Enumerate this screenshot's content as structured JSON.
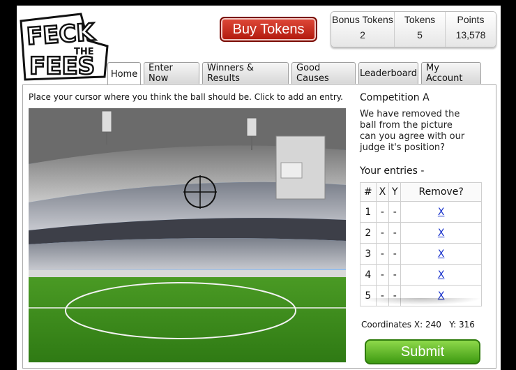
{
  "brand": {
    "logo_text_top": "FECK",
    "logo_text_mid": "THE",
    "logo_text_bottom": "FEES"
  },
  "header": {
    "buy_tokens_label": "Buy Tokens"
  },
  "stats": [
    {
      "label": "Bonus Tokens",
      "value": "2"
    },
    {
      "label": "Tokens",
      "value": "5"
    },
    {
      "label": "Points",
      "value": "13,578"
    }
  ],
  "tabs": [
    {
      "label": "Home",
      "active": true
    },
    {
      "label": "Enter Now",
      "active": false
    },
    {
      "label": "Winners & Results",
      "active": false
    },
    {
      "label": "Good Causes",
      "active": false
    },
    {
      "label": "Leaderboard",
      "active": false
    },
    {
      "label": "My Account",
      "active": false
    }
  ],
  "instructions": "Place your cursor where you think the ball should be. Click to add an entry.",
  "competition": {
    "title": "Competition A",
    "description": "We have removed the ball from the picture can you agree with our judge it's position?"
  },
  "entries": {
    "title": "Your entries -",
    "headers": [
      "#",
      "X",
      "Y",
      "Remove?"
    ],
    "rows": [
      {
        "num": "1",
        "x": "-",
        "y": "-",
        "remove": "X"
      },
      {
        "num": "2",
        "x": "-",
        "y": "-",
        "remove": "X"
      },
      {
        "num": "3",
        "x": "-",
        "y": "-",
        "remove": "X"
      },
      {
        "num": "4",
        "x": "-",
        "y": "-",
        "remove": "X"
      },
      {
        "num": "5",
        "x": "-",
        "y": "-",
        "remove": "X"
      }
    ]
  },
  "coordinates": {
    "label": "Coordinates",
    "x_label": "X:",
    "x": "240",
    "y_label": "Y:",
    "y": "316"
  },
  "submit_label": "Submit",
  "colors": {
    "buy_tokens": "#c8261a",
    "submit": "#5cb82a",
    "link": "#1a33cc",
    "pitch": "#3f8f1e",
    "sky": "#6fa8e6"
  }
}
